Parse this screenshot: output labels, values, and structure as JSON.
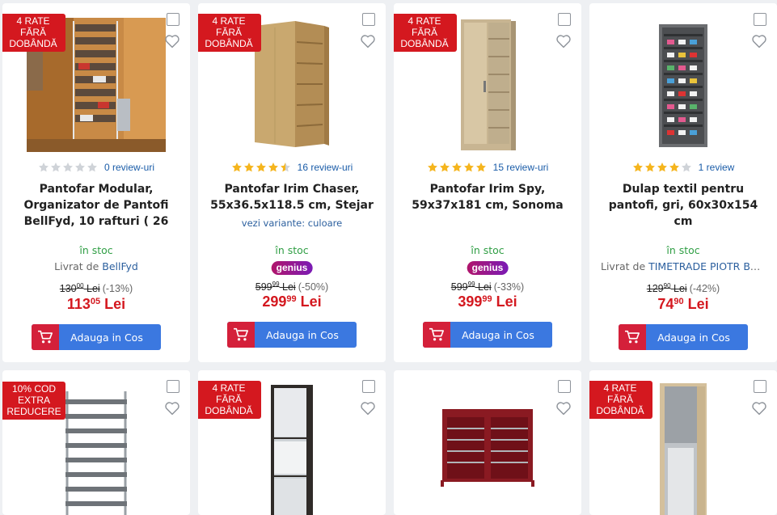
{
  "products": [
    {
      "badge": "4 RATE FĂRĂ DOBÂNDĂ",
      "review_text": "0 review-uri",
      "rating": 0,
      "title": "Pantofar Modular, Organizator de Pantofi BellFyd, 10 rafturi ( 26",
      "stock": "în stoc",
      "seller_prefix": "Livrat de ",
      "seller_name": "BellFyd",
      "old_price_int": "130",
      "old_price_dec": "00",
      "old_price_currency": "Lei",
      "discount": "(-13%)",
      "price_int": "113",
      "price_dec": "05",
      "price_currency": "Lei",
      "button_label": "Adauga in Cos",
      "image": "shoe-rack-photo"
    },
    {
      "badge": "4 RATE FĂRĂ DOBÂNDĂ",
      "review_text": "16 review-uri",
      "rating": 4.5,
      "title": "Pantofar Irim Chaser, 55x36.5x118.5 cm, Stejar",
      "variants": "vezi variante: culoare",
      "stock": "în stoc",
      "genius": "genius",
      "old_price_int": "599",
      "old_price_dec": "99",
      "old_price_currency": "Lei",
      "discount": "(-50%)",
      "price_int": "299",
      "price_dec": "99",
      "price_currency": "Lei",
      "button_label": "Adauga in Cos",
      "image": "oak-cabinet"
    },
    {
      "badge": "4 RATE FĂRĂ DOBÂNDĂ",
      "review_text": "15 review-uri",
      "rating": 5,
      "title": "Pantofar Irim Spy, 59x37x181 cm, Sonoma",
      "stock": "în stoc",
      "genius": "genius",
      "old_price_int": "599",
      "old_price_dec": "99",
      "old_price_currency": "Lei",
      "discount": "(-33%)",
      "price_int": "399",
      "price_dec": "99",
      "price_currency": "Lei",
      "button_label": "Adauga in Cos",
      "image": "sonoma-cabinet"
    },
    {
      "review_text": "1 review",
      "rating": 4,
      "title": "Dulap textil pentru pantofi, gri, 60x30x154 cm",
      "stock": "în stoc",
      "seller_prefix": "Livrat de ",
      "seller_name": "TIMETRADE PIOTR BO...",
      "old_price_int": "129",
      "old_price_dec": "90",
      "old_price_currency": "Lei",
      "discount": "(-42%)",
      "price_int": "74",
      "price_dec": "90",
      "price_currency": "Lei",
      "button_label": "Adauga in Cos",
      "image": "grey-textile-cabinet"
    },
    {
      "badge": "10% COD EXTRA REDUCERE",
      "image": "metal-shoe-rack"
    },
    {
      "badge": "4 RATE FĂRĂ DOBÂNDĂ",
      "image": "mirror-cabinet-dark"
    },
    {
      "image": "red-textile-cabinet"
    },
    {
      "badge": "4 RATE FĂRĂ DOBÂNDĂ",
      "image": "mirror-cabinet-sonoma"
    }
  ],
  "colors": {
    "badge_red": "#d4181f",
    "price_red": "#d4181f",
    "stock_green": "#2f9e44",
    "link_blue": "#2b5f9e",
    "cart_blue": "#3b78e0",
    "cart_icon_red": "#d4203a",
    "star_gold": "#f5b51e",
    "star_empty": "#cfd3d8"
  }
}
